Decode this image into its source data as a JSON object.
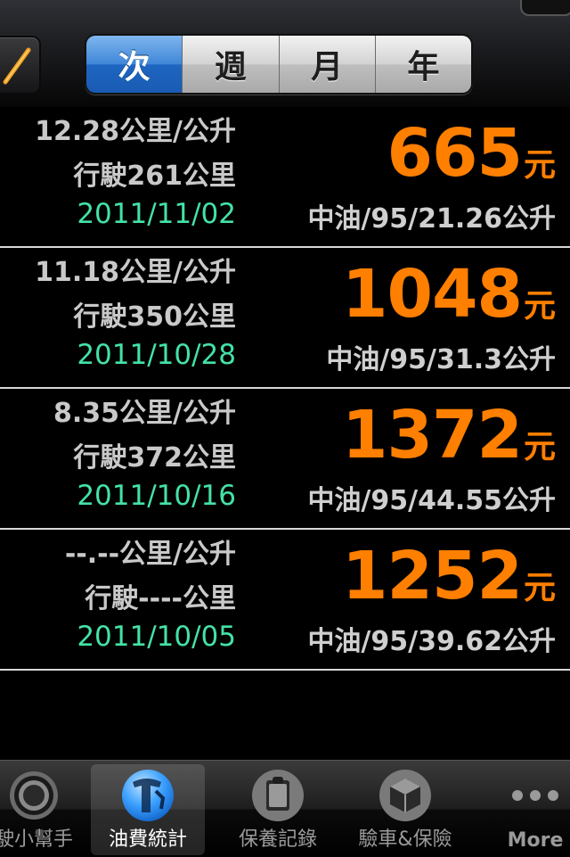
{
  "segmented": {
    "options": [
      "次",
      "週",
      "月",
      "年"
    ],
    "selected": "次"
  },
  "records": [
    {
      "efficiency": "12.28公里/公升",
      "distance": "行駛261公里",
      "date": "2011/11/02",
      "amount": "665",
      "currency": "元",
      "fuel_info": "中油/95/21.26公升"
    },
    {
      "efficiency": "11.18公里/公升",
      "distance": "行駛350公里",
      "date": "2011/10/28",
      "amount": "1048",
      "currency": "元",
      "fuel_info": "中油/95/31.3公升"
    },
    {
      "efficiency": "8.35公里/公升",
      "distance": "行駛372公里",
      "date": "2011/10/16",
      "amount": "1372",
      "currency": "元",
      "fuel_info": "中油/95/44.55公升"
    },
    {
      "efficiency": "--.--公里/公升",
      "distance": "行駛----公里",
      "date": "2011/10/05",
      "amount": "1252",
      "currency": "元",
      "fuel_info": "中油/95/39.62公升"
    }
  ],
  "tabs": [
    {
      "label": "駛小幫手",
      "icon": "steering-icon",
      "selected": false
    },
    {
      "label": "油費統計",
      "icon": "fuel-pump-icon",
      "selected": true
    },
    {
      "label": "保養記錄",
      "icon": "clipboard-icon",
      "selected": false
    },
    {
      "label": "驗車&保險",
      "icon": "box-icon",
      "selected": false
    },
    {
      "label": "More",
      "icon": "more-dots-icon",
      "selected": false
    }
  ],
  "colors": {
    "amount": "#ff7f00",
    "date": "#44e2a6",
    "segment_active": "#2a74cc"
  }
}
